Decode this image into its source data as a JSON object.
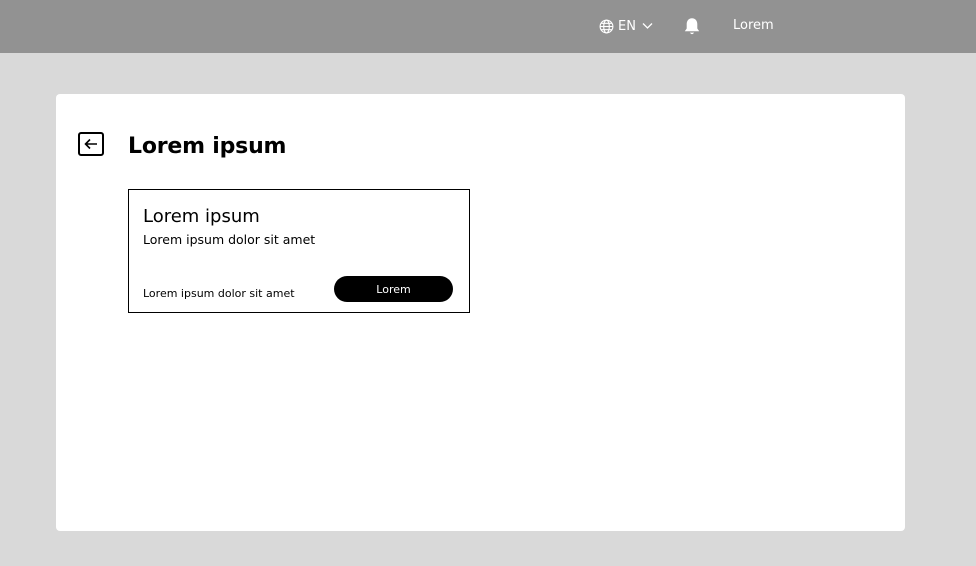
{
  "header": {
    "language": {
      "icon": "globe-icon",
      "label": "EN",
      "dropdown_icon": "chevron-down-icon"
    },
    "notifications": {
      "icon": "bell-icon"
    },
    "user_label": "Lorem"
  },
  "page": {
    "back_icon": "arrow-left-icon",
    "title": "Lorem ipsum",
    "item": {
      "title": "Lorem ipsum",
      "subtitle": "Lorem ipsum dolor sit amet",
      "footer_text": "Lorem ipsum dolor sit amet",
      "button_label": "Lorem"
    }
  },
  "colors": {
    "topbar": "#929292",
    "background": "#d9d9d9",
    "card": "#ffffff",
    "button": "#000000"
  }
}
